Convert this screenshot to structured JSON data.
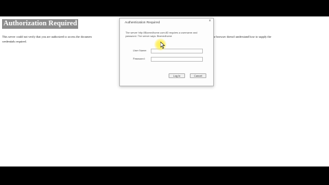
{
  "page": {
    "heading": "Authorization Required",
    "body_text_left": "This server could not verify that you are authorized to access the documen",
    "body_text_right": "nd password), or your browser doesn't understand how to supply the",
    "body_text_line2": "credentials required."
  },
  "dialog": {
    "title": "Authentication Required",
    "close_label": "×",
    "message": "The server http://Biomedhome.com:80 requires a username and password. The server says: Biomedhome",
    "username_label": "User Name:",
    "username_value": "",
    "password_label": "Password:",
    "password_value": "",
    "login_label": "Log In",
    "cancel_label": "Cancel"
  },
  "colors": {
    "letterbox": "#000000",
    "heading_bg": "#8c8c8c",
    "cursor_highlight": "#ffec3c"
  },
  "icons": {
    "cursor": "arrow-cursor-icon",
    "close": "close-icon"
  }
}
